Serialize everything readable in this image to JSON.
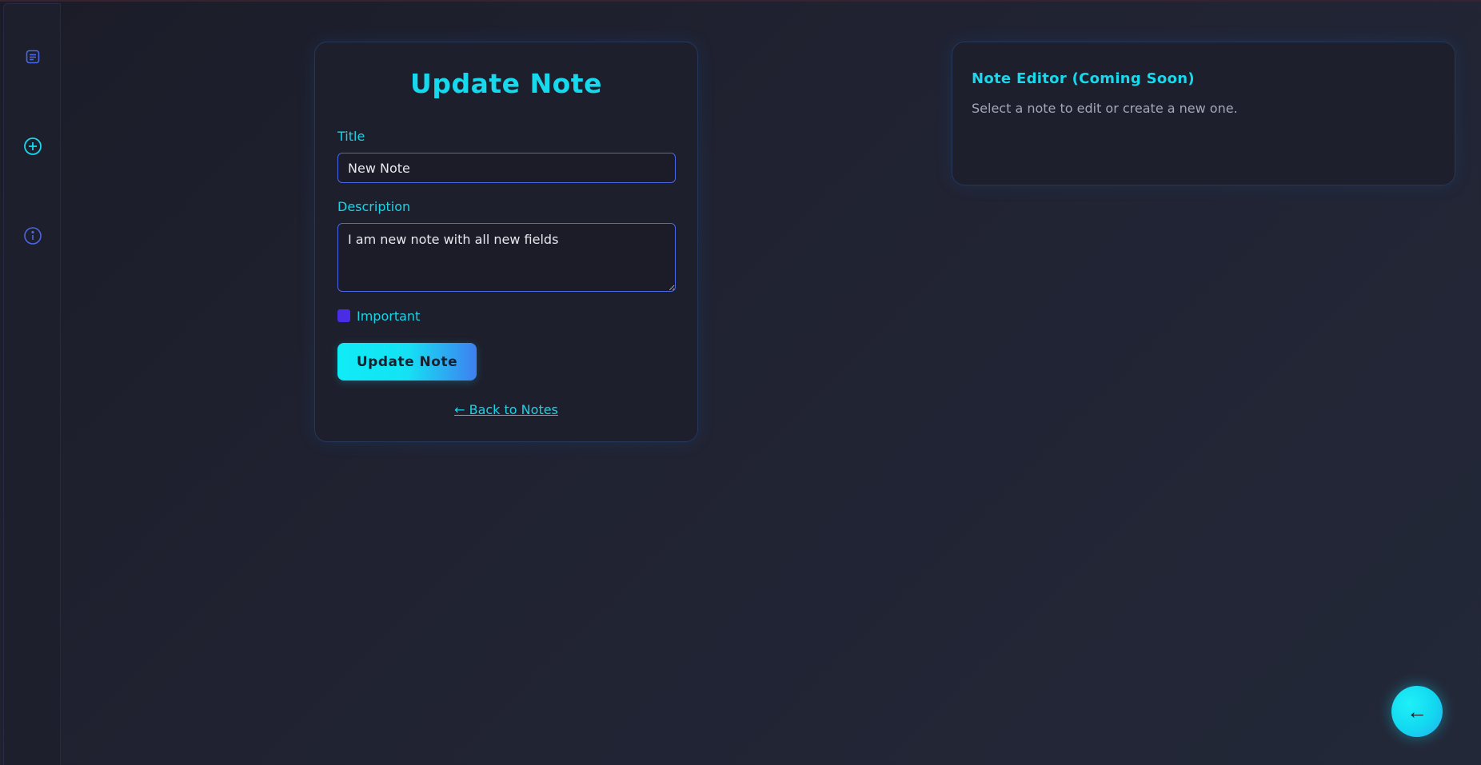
{
  "sidebar": {
    "items": [
      {
        "icon": "notes-icon",
        "color": "#4a67e6"
      },
      {
        "icon": "add-circle-icon",
        "color": "#16d9ee"
      },
      {
        "icon": "info-icon",
        "color": "#4a67e6"
      }
    ]
  },
  "form": {
    "title": "Update Note",
    "title_label": "Title",
    "title_value": "New Note",
    "description_label": "Description",
    "description_value": "I am new note with all new fields",
    "important_label": "Important",
    "important_checked": true,
    "submit_label": "Update Note",
    "back_link": "← Back to Notes"
  },
  "editor": {
    "title": "Note Editor (Coming Soon)",
    "text": "Select a note to edit or create a new one."
  },
  "fab": {
    "icon": "arrow-left-icon",
    "glyph": "←"
  },
  "colors": {
    "accent": "#16d9ee",
    "border": "#4a67e6",
    "checkbox": "#4b2ce6",
    "background": "#1e1f2c"
  }
}
